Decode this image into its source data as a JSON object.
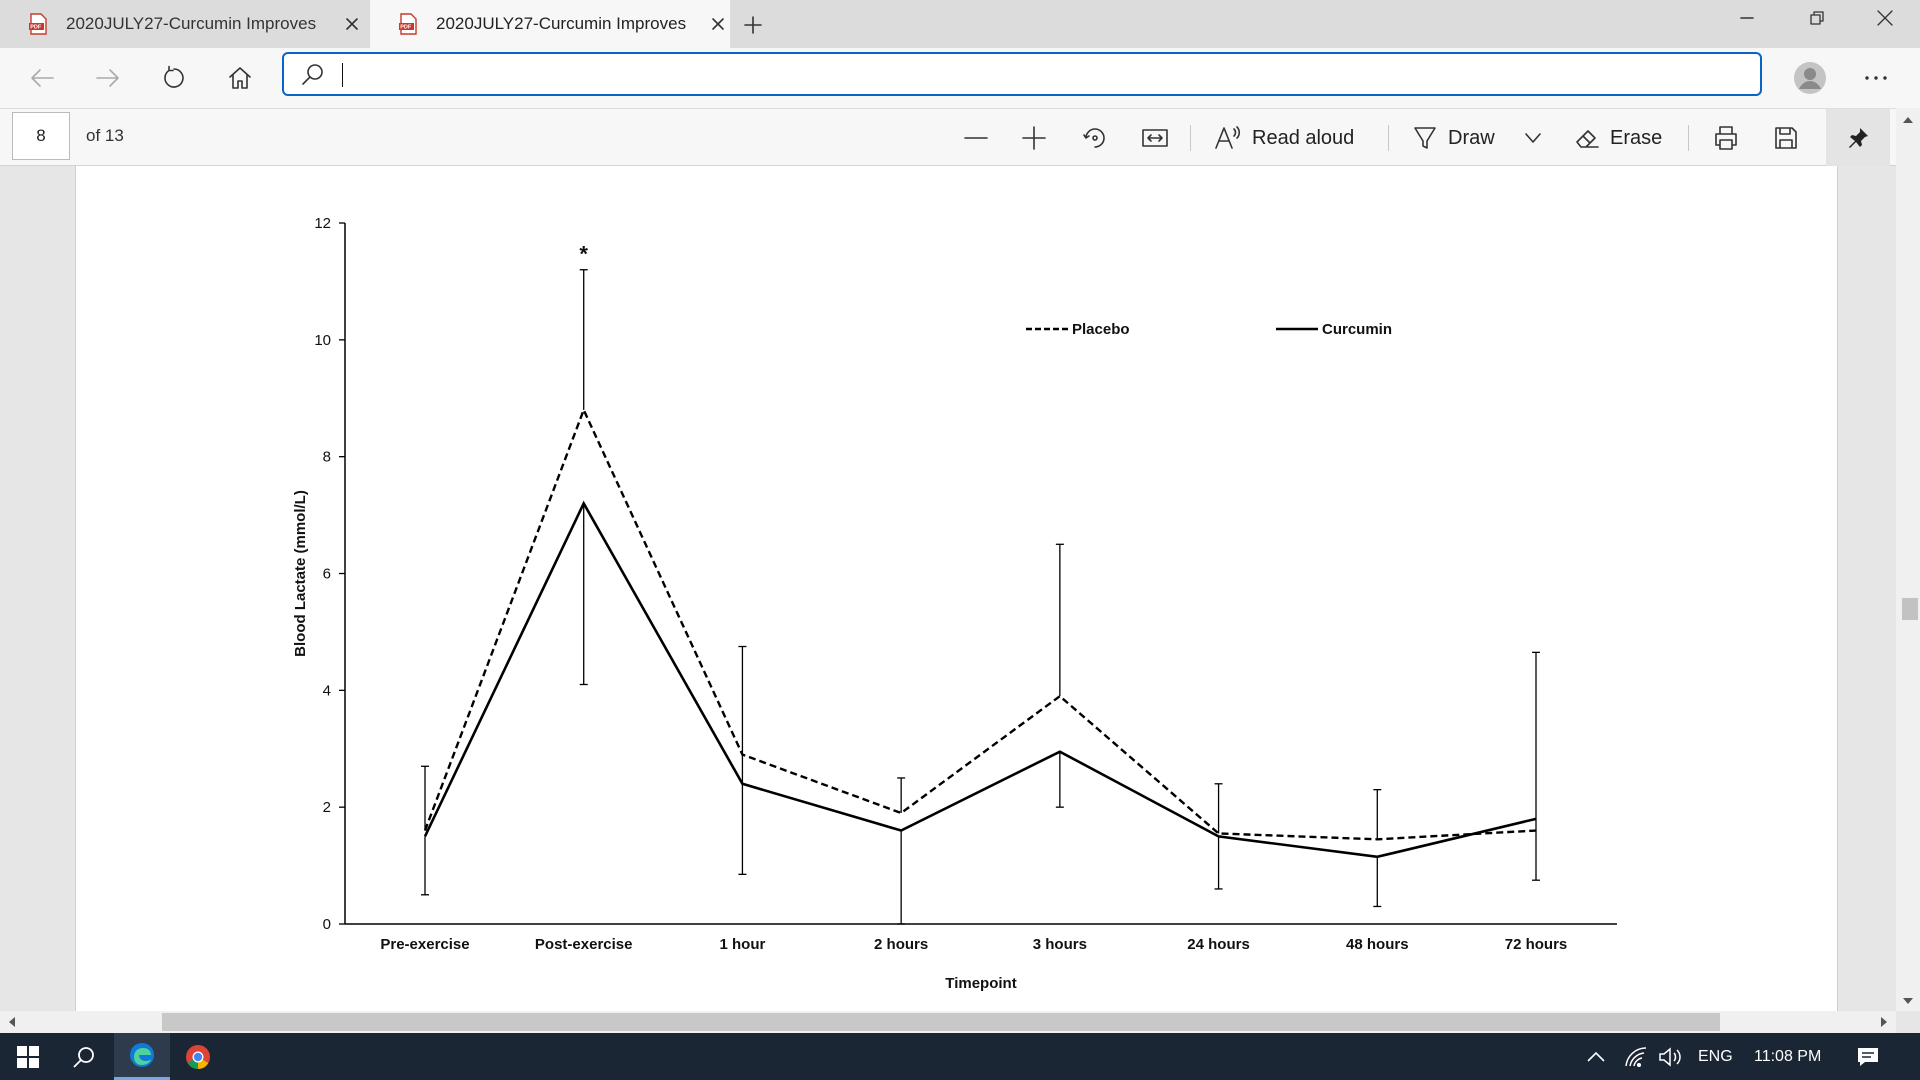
{
  "tabs": [
    {
      "title": "2020JULY27-Curcumin Improves",
      "icon": "pdf-icon",
      "active": false
    },
    {
      "title": "2020JULY27-Curcumin Improves",
      "icon": "pdf-icon",
      "active": true
    }
  ],
  "address_bar": {
    "value": "",
    "placeholder": ""
  },
  "pdf_toolbar": {
    "page_number": "8",
    "page_count": "of 13",
    "read_aloud": "Read aloud",
    "draw": "Draw",
    "erase": "Erase"
  },
  "taskbar": {
    "language": "ENG",
    "time": "11:08 PM"
  },
  "colors": {
    "taskbar": "#1b2634",
    "address_focus": "#0a64c8",
    "edge_blue": "#0f7bd7"
  },
  "chart_data": {
    "type": "line",
    "title": "",
    "xlabel": "Timepoint",
    "ylabel": "Blood Lactate (mmol/L)",
    "ylim": [
      0,
      12
    ],
    "yticks": [
      "0",
      "2",
      "4",
      "6",
      "8",
      "10",
      "12"
    ],
    "categories": [
      "Pre-exercise",
      "Post-exercise",
      "1 hour",
      "2 hours",
      "3 hours",
      "24 hours",
      "48 hours",
      "72 hours"
    ],
    "legend_position": "top-right",
    "significance_marker": {
      "category": "Post-exercise",
      "label": "*"
    },
    "series": [
      {
        "name": "Placebo",
        "style": "dashed",
        "values": [
          1.6,
          8.8,
          2.9,
          1.9,
          3.9,
          1.55,
          1.45,
          1.6
        ],
        "error_upper": [
          2.7,
          11.2,
          null,
          2.5,
          6.5,
          2.4,
          2.3,
          null
        ]
      },
      {
        "name": "Curcumin",
        "style": "solid",
        "values": [
          1.5,
          7.2,
          2.4,
          1.6,
          2.95,
          1.5,
          1.15,
          1.8
        ],
        "error_lower": [
          0.5,
          4.1,
          0.85,
          0.0,
          2.0,
          0.6,
          0.3,
          0.75
        ],
        "error_upper": [
          null,
          null,
          4.75,
          null,
          null,
          null,
          null,
          4.65
        ]
      }
    ]
  }
}
